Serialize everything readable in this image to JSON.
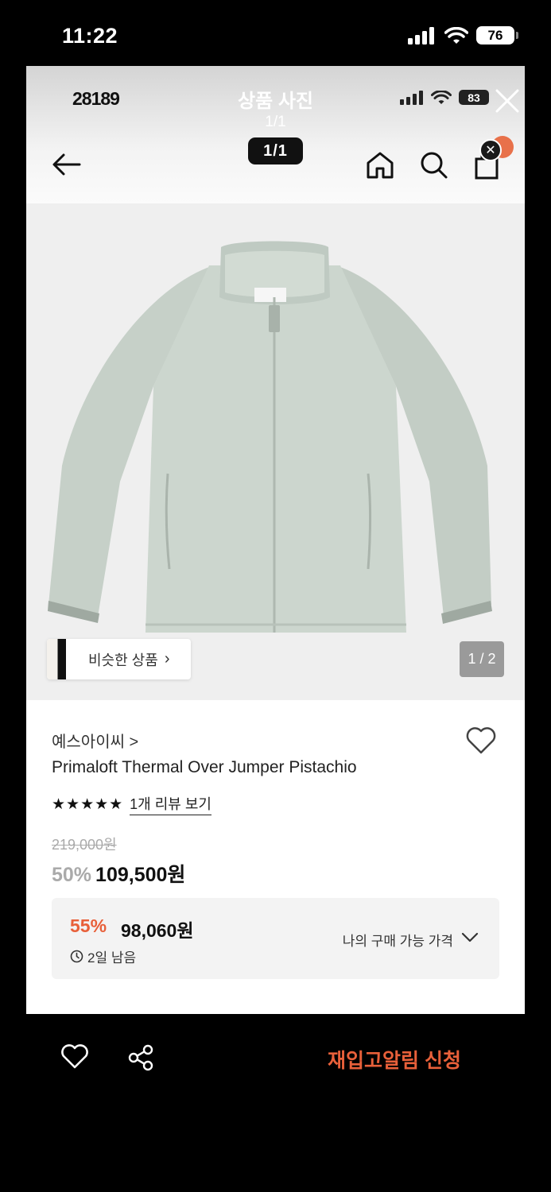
{
  "status_bar": {
    "time": "11:22",
    "battery": "76"
  },
  "viewer": {
    "inner_time": "28189",
    "inner_battery": "83",
    "title": "상품 사진",
    "count": "1/1",
    "page_pill": "1/1"
  },
  "photo": {
    "similar_label": "비슷한 상품",
    "counter": "1 / 2"
  },
  "product": {
    "brand": "예스아이씨 >",
    "title": "Primaloft Thermal Over Jumper Pistachio",
    "stars": "★★★★★",
    "review_link": "1개 리뷰 보기",
    "original_price": "219,000원",
    "discount": "50%",
    "price": "109,500원"
  },
  "my_price": {
    "discount": "55%",
    "amount": "98,060원",
    "remaining": "2일 남음",
    "label": "나의 구매 가능 가격"
  },
  "bottom_bar": {
    "restock_label": "재입고알림 신청"
  },
  "colors": {
    "accent": "#e8603a",
    "jacket": "#c9d3cb"
  }
}
